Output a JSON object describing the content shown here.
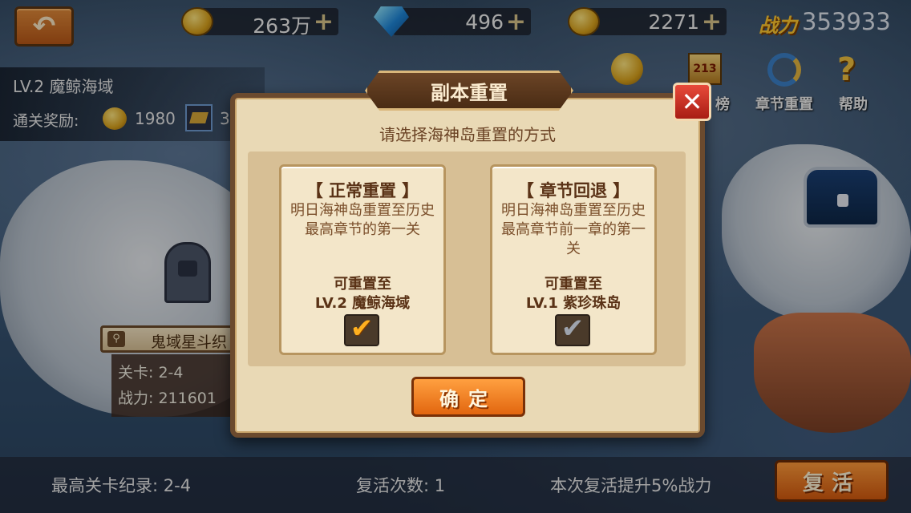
{
  "topbar": {
    "gold": "263万",
    "diamonds": "496",
    "stamina": "2271",
    "power_label": "战力",
    "power_value": "353933",
    "plus": "+"
  },
  "stage": {
    "name": "LV.2  魔鲸海域",
    "reward_label": "通关奖励:",
    "reward_gold": "1980",
    "reward_trunc": "3"
  },
  "icon_buttons": {
    "rank_label": "榜",
    "chapter_reset_label": "章节重置",
    "help_label": "帮助"
  },
  "stage_card": {
    "name": "鬼域星斗织",
    "level": "关卡: 2-4",
    "power": "战力: 211601"
  },
  "dialog": {
    "title": "副本重置",
    "close": "✕",
    "prompt": "请选择海神岛重置的方式",
    "option_normal": {
      "title": "【 正常重置 】",
      "desc": "明日海神岛重置至历史最高章节的第一关",
      "can_reset": "可重置至",
      "target": "LV.2  魔鲸海域",
      "checked": true
    },
    "option_rollback": {
      "title": "【 章节回退 】",
      "desc": "明日海神岛重置至历史最高章节前一章的第一关",
      "can_reset": "可重置至",
      "target": "LV.1  紫珍珠岛",
      "checked": false
    },
    "confirm": "确定"
  },
  "footer": {
    "best_record": "最高关卡纪录: 2-4",
    "revive_count": "复活次数: 1",
    "revive_bonus": "本次复活提升5%战力",
    "revive_button": "复活"
  },
  "icons": {
    "back": "back-arrow-icon",
    "gold": "gold-coin-icon",
    "diamond": "diamond-icon",
    "stamina": "gold-orb-icon",
    "check_on": "✔",
    "check_off": "✔"
  }
}
